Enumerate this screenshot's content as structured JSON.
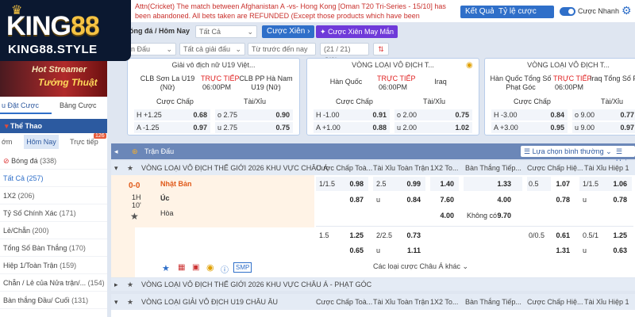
{
  "logo": {
    "text_main": "KING",
    "text_num": "88",
    "text_sub": "KING88.STYLE"
  },
  "ticker": {
    "line1": "Attn(Cricket) The match between Afghanistan A -vs- Hong Kong [Oman T20 Tri-Series - 15/10] has",
    "line2": "been abandoned. All bets taken are REFUNDED (Except those products which have been determined"
  },
  "topbar": {
    "results_label": "Kết Quả",
    "odds_label": "Tỷ lệ cược CN",
    "quick_bet_label": "Cược Nhanh"
  },
  "filters": {
    "sport_label": "óng đá / Hôm Nay",
    "all_label": "Tất Cả",
    "cross_bet_label": "Cược Xiên",
    "lucky_cross_label": "Cược Xiên May Mắn",
    "match_select": "c Trận Đấu",
    "league_select": "Tất cả giải đấu",
    "sort_select": "Từ trước đến nay",
    "count_label": "(21 / 21) Giải"
  },
  "banner": {
    "line1": "Hot Streamer",
    "line2": "Tướng Thuật"
  },
  "sidetabs": {
    "tab1": "u Đặt Cược",
    "tab2": "Bảng Cược"
  },
  "sport_header": "Thể Thao",
  "subtabs": {
    "tab1": "ớm",
    "tab2": "Hôm Nay",
    "tab3": "Trực tiếp",
    "badge": "126"
  },
  "menu": [
    {
      "label": "Bóng đá",
      "count": "(338)"
    },
    {
      "label": "Tất Cả",
      "count": "(257)"
    },
    {
      "label": "1X2",
      "count": "(206)"
    },
    {
      "label": "Tỷ Số Chính Xác",
      "count": "(171)"
    },
    {
      "label": "Lẻ/Chẵn",
      "count": "(200)"
    },
    {
      "label": "Tổng Số Bàn Thắng",
      "count": "(170)"
    },
    {
      "label": "Hiệp 1/Toàn Trận",
      "count": "(159)"
    },
    {
      "label": "Chẵn / Lẻ của Nửa trận/...",
      "count": "(154)"
    },
    {
      "label": "Bàn thắng Đầu/ Cuối",
      "count": "(131)"
    }
  ],
  "cards": [
    {
      "league": "Giải vô địch nữ U19 Việt...",
      "home": "CLB Sơn La U19 (Nữ)",
      "away": "CLB PP Hà Nam U19 (Nữ)",
      "live": "TRỰC TIẾP",
      "time": "06:00PM",
      "hcap_label": "Cược Chấp",
      "ou_label": "Tài/Xỉu",
      "r1": {
        "h": "H +1.25",
        "hv": "0.68",
        "o": "o 2.75",
        "ov": "0.90"
      },
      "r2": {
        "a": "A -1.25",
        "av": "0.97",
        "u": "u 2.75",
        "uv": "0.75"
      }
    },
    {
      "league": "VÒNG LOẠI VÔ ĐỊCH T...",
      "home": "Hàn Quốc",
      "away": "Iraq",
      "live": "TRỰC TIẾP",
      "time": "06:00PM",
      "hcap_label": "Cược Chấp",
      "ou_label": "Tài/Xỉu",
      "r1": {
        "h": "H -1.00",
        "hv": "0.91",
        "o": "o 2.00",
        "ov": "0.75"
      },
      "r2": {
        "a": "A +1.00",
        "av": "0.88",
        "u": "u 2.00",
        "uv": "1.02"
      }
    },
    {
      "league": "VÒNG LOẠI VÔ ĐỊCH T...",
      "home": "Hàn Quốc Tổng Số Phạt Góc",
      "away": "Iraq Tổng Số Phạt Góc",
      "live": "TRỰC TIẾP",
      "time": "06:00PM",
      "hcap_label": "Cược Chấp",
      "ou_label": "Tài/Xỉu",
      "r1": {
        "h": "H -3.00",
        "hv": "0.84",
        "o": "o 9.00",
        "ov": "0.77"
      },
      "r2": {
        "a": "A +3.00",
        "av": "0.95",
        "u": "u 9.00",
        "uv": "0.97"
      }
    }
  ],
  "main": {
    "title": "Trận Đấu",
    "view_label": "Lựa chọn bình thường",
    "more_label": "Hai",
    "league1": "VÒNG LOẠI VÔ ĐỊCH THẾ GIỚI 2026 KHU VỰC CHÂU Á",
    "cols": [
      "Cược Chấp Toà...",
      "Tài Xỉu Toàn Trận",
      "1X2 To...",
      "Bàn Thắng Tiếp...",
      "Cược Chấp Hiệ...",
      "Tài Xỉu Hiệp 1"
    ],
    "score": "0-0",
    "half": "1H",
    "minute": "10'",
    "home": "Nhật Bản",
    "away": "Úc",
    "draw": "Hòa",
    "r1": {
      "hc": "1/1.5",
      "hcv": "0.98",
      "ou": "2.5",
      "ouv": "0.99",
      "x1": "1.40",
      "ng": "1.33",
      "h1": "0.5",
      "h1v": "1.07",
      "t1": "1/1.5",
      "t1v": "1.06"
    },
    "r2": {
      "hcv": "0.87",
      "ou": "u",
      "ouv": "0.84",
      "x2": "7.60",
      "ng": "4.00",
      "h1v": "0.78",
      "t1": "u",
      "t1v": "0.78"
    },
    "r3": {
      "xd": "4.00",
      "ng_label": "Không có",
      "ng": "9.70"
    },
    "r4": {
      "hc": "1.5",
      "hcv": "1.25",
      "ou": "2/2.5",
      "ouv": "0.73",
      "h1": "0/0.5",
      "h1v": "0.61",
      "t1": "0.5/1",
      "t1v": "1.25"
    },
    "r5": {
      "hcv": "0.65",
      "ou": "u",
      "ouv": "1.11",
      "h1v": "1.31",
      "t1": "u",
      "t1v": "0.63"
    },
    "smp_label": "SMP",
    "other_label": "Các loại cược Châu Á khác",
    "league2": "VÒNG LOẠI VÔ ĐỊCH THẾ GIỚI 2026 KHU VỰC CHÂU Á - PHẠT GÓC",
    "league3": "VÒNG LOẠI GIẢI VÔ ĐỊCH U19 CHÂU ÂU",
    "cols3": [
      "Cược Chấp Toà...",
      "Tài Xỉu Toàn Trận",
      "1X2 To...",
      "Bàn Thắng Tiếp...",
      "Cược Chấp Hiệ...",
      "Tài Xỉu Hiệp 1"
    ]
  }
}
